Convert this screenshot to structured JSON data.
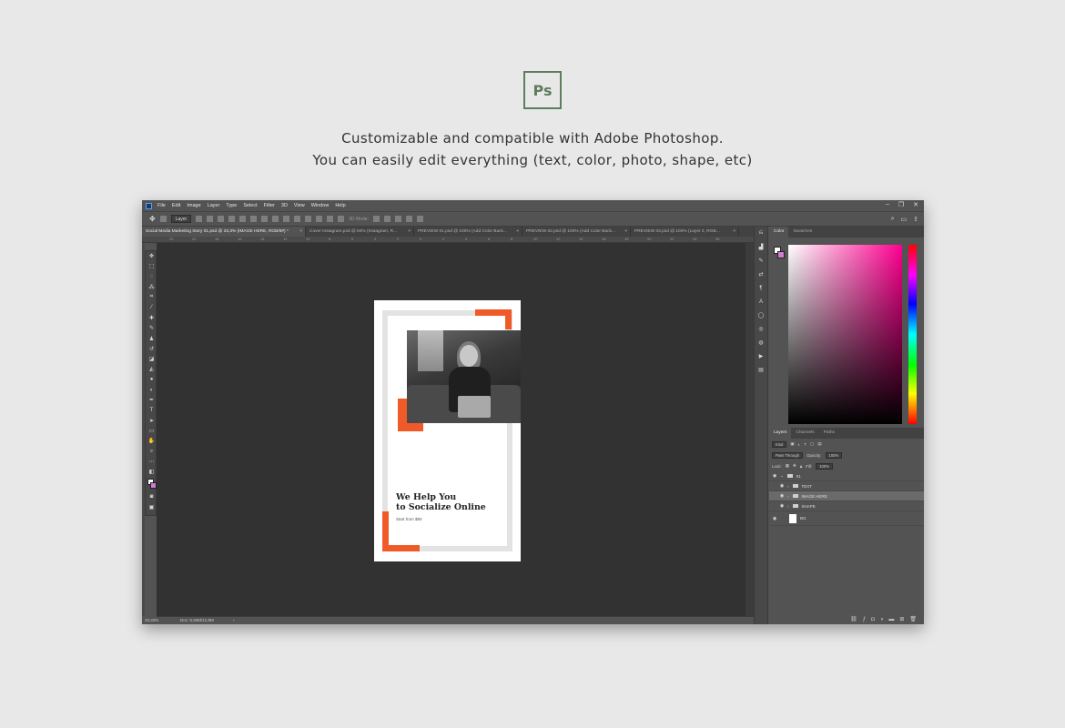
{
  "header": {
    "logo_text": "Ps",
    "tagline_1": "Customizable and compatible with Adobe Photoshop.",
    "tagline_2": "You can easily edit everything (text, color, photo, shape, etc)"
  },
  "menubar": {
    "items": [
      "File",
      "Edit",
      "Image",
      "Layer",
      "Type",
      "Select",
      "Filter",
      "3D",
      "View",
      "Window",
      "Help"
    ],
    "controls": [
      "–",
      "❐",
      "✕"
    ]
  },
  "optionsbar": {
    "move_target": "Layer",
    "mode_3d": "3D Mode:"
  },
  "tabs": [
    {
      "label": "Social Media Marketing Story 01.psd @ 33,3% (IMAGE HERE, RGB/8#) *",
      "close": "×"
    },
    {
      "label": "Cover Instagram.psd @ 50% (Instagram, R...",
      "close": "×"
    },
    {
      "label": "PREVIEW 01.psd @ 100% (Add Color Back...",
      "close": "×"
    },
    {
      "label": "PREVIEW 02.psd @ 100% (Add Color Back...",
      "close": "×"
    },
    {
      "label": "PREVIEW 03.psd @ 100% (Layer 2, RGB...",
      "close": "×"
    }
  ],
  "ruler_ticks": [
    "22",
    "20",
    "18",
    "16",
    "14",
    "12",
    "10",
    "8",
    "6",
    "4",
    "2",
    "0",
    "2",
    "4",
    "6",
    "8",
    "10",
    "12",
    "14",
    "16",
    "18",
    "20",
    "22",
    "24",
    "26"
  ],
  "document": {
    "heading_line1": "We Help You",
    "heading_line2": "to Socialize Online",
    "subtext": "Start from $90",
    "accent_color": "#f05a28"
  },
  "status": {
    "zoom": "33,33%",
    "doc_size": "Doc: 5,93M/12,8M"
  },
  "color_panel": {
    "tabs": [
      "Color",
      "Swatches"
    ],
    "foreground": "#ffffff",
    "background": "#d17cd1"
  },
  "layers_panel": {
    "tabs": [
      "Layers",
      "Channels",
      "Paths"
    ],
    "filter": "Kind",
    "blend_mode": "Pass Through",
    "opacity_label": "Opacity:",
    "opacity_value": "100%",
    "lock_label": "Lock:",
    "fill_label": "Fill:",
    "fill_value": "100%",
    "layers": [
      {
        "name": "01",
        "type": "group",
        "selected": false
      },
      {
        "name": "TEXT",
        "type": "group",
        "selected": false
      },
      {
        "name": "IMAGE HERE",
        "type": "group",
        "selected": true
      },
      {
        "name": "SHAPE",
        "type": "group",
        "selected": false
      },
      {
        "name": "BG",
        "type": "layer",
        "selected": false
      }
    ]
  }
}
